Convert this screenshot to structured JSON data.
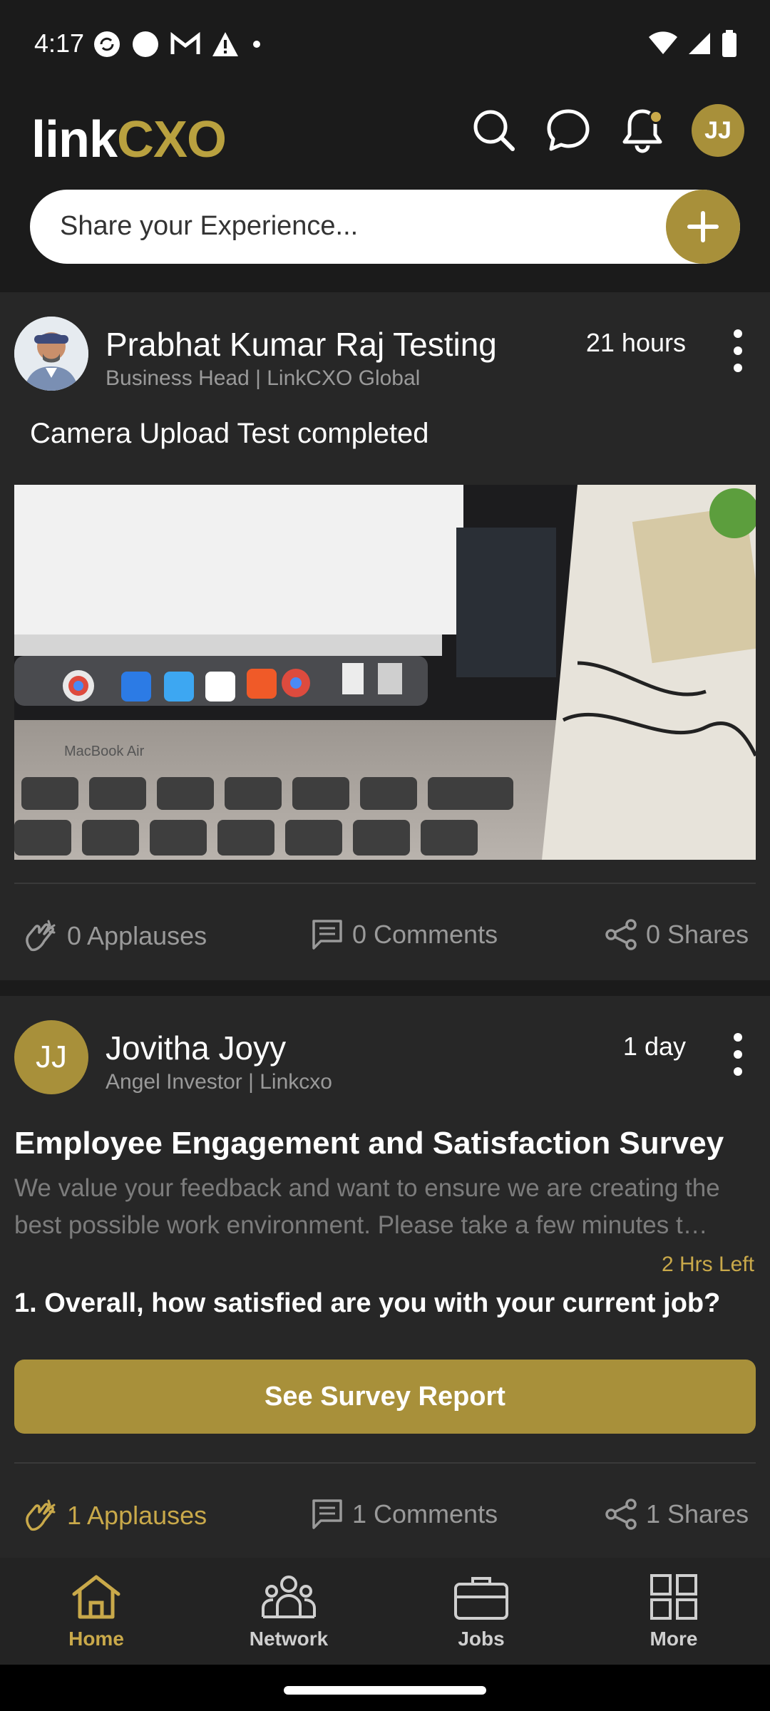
{
  "status_bar": {
    "time": "4:17"
  },
  "header": {
    "logo_part1": "link",
    "logo_part2": "CXO",
    "avatar_initials": "JJ",
    "icons": [
      "search-icon",
      "chat-icon",
      "bell-icon"
    ]
  },
  "share": {
    "placeholder": "Share your Experience..."
  },
  "posts": [
    {
      "author": "Prabhat Kumar Raj Testing",
      "subtitle": "Business Head | LinkCXO Global",
      "time": "21 hours",
      "text": "Camera Upload Test completed",
      "applauses": "0 Applauses",
      "comments": "0 Comments",
      "shares": "0 Shares"
    },
    {
      "author": "Jovitha Joyy",
      "avatar_initials": "JJ",
      "subtitle": "Angel Investor | Linkcxo",
      "time": "1 day",
      "survey_title": "Employee Engagement and Satisfaction Survey",
      "survey_description": "We value your feedback and want to ensure we are creating the best possible work environment. Please take a few minutes t…",
      "time_left": "2 Hrs Left",
      "question": "1. Overall, how satisfied are you with your current job?",
      "button_label": "See Survey Report",
      "applauses": "1 Applauses",
      "comments": "1 Comments",
      "shares": "1 Shares"
    }
  ],
  "bottom_nav": {
    "items": [
      {
        "label": "Home",
        "icon": "home-icon",
        "active": true
      },
      {
        "label": "Network",
        "icon": "network-icon",
        "active": false
      },
      {
        "label": "Jobs",
        "icon": "briefcase-icon",
        "active": false
      },
      {
        "label": "More",
        "icon": "grid-icon",
        "active": false
      }
    ]
  },
  "colors": {
    "accent_gold": "#a8903a",
    "accent_gold_text": "#c9a94a",
    "background": "#1b1b1b",
    "card": "#272727"
  }
}
